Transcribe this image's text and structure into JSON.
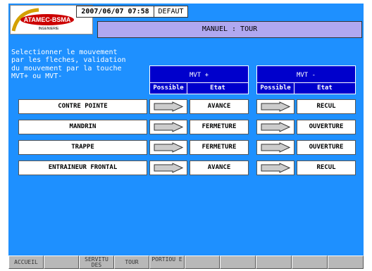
{
  "header": {
    "datetime": "2007/06/07 07:58",
    "mode": "DEFAUT",
    "title": "MANUEL : TOUR",
    "logo_text": "ATAMEC-BSMA",
    "logo_sub": "INGENIERIE"
  },
  "instructions": "Selectionner le mouvement\npar les fleches, validation\ndu mouvement par la touche\nMVT+ ou MVT-",
  "table": {
    "group_plus": "MVT +",
    "group_minus": "MVT -",
    "col_possible": "Possible",
    "col_etat": "Etat",
    "rows": [
      {
        "label": "CONTRE POINTE",
        "plus_state": "AVANCE",
        "minus_state": "RECUL"
      },
      {
        "label": "MANDRIN",
        "plus_state": "FERMETURE",
        "minus_state": "OUVERTURE"
      },
      {
        "label": "TRAPPE",
        "plus_state": "FERMETURE",
        "minus_state": "OUVERTURE"
      },
      {
        "label": "ENTRAINEUR FRONTAL",
        "plus_state": "AVANCE",
        "minus_state": "RECUL"
      }
    ]
  },
  "footer": {
    "buttons": [
      "ACCUEIL",
      "",
      "SERVITU DES",
      "TOUR",
      "PORTIOU E",
      "",
      "",
      "",
      "",
      ""
    ]
  },
  "colors": {
    "background": "#1e90ff",
    "header_blue": "#0000cc",
    "title_bar": "#b0a8f0"
  }
}
